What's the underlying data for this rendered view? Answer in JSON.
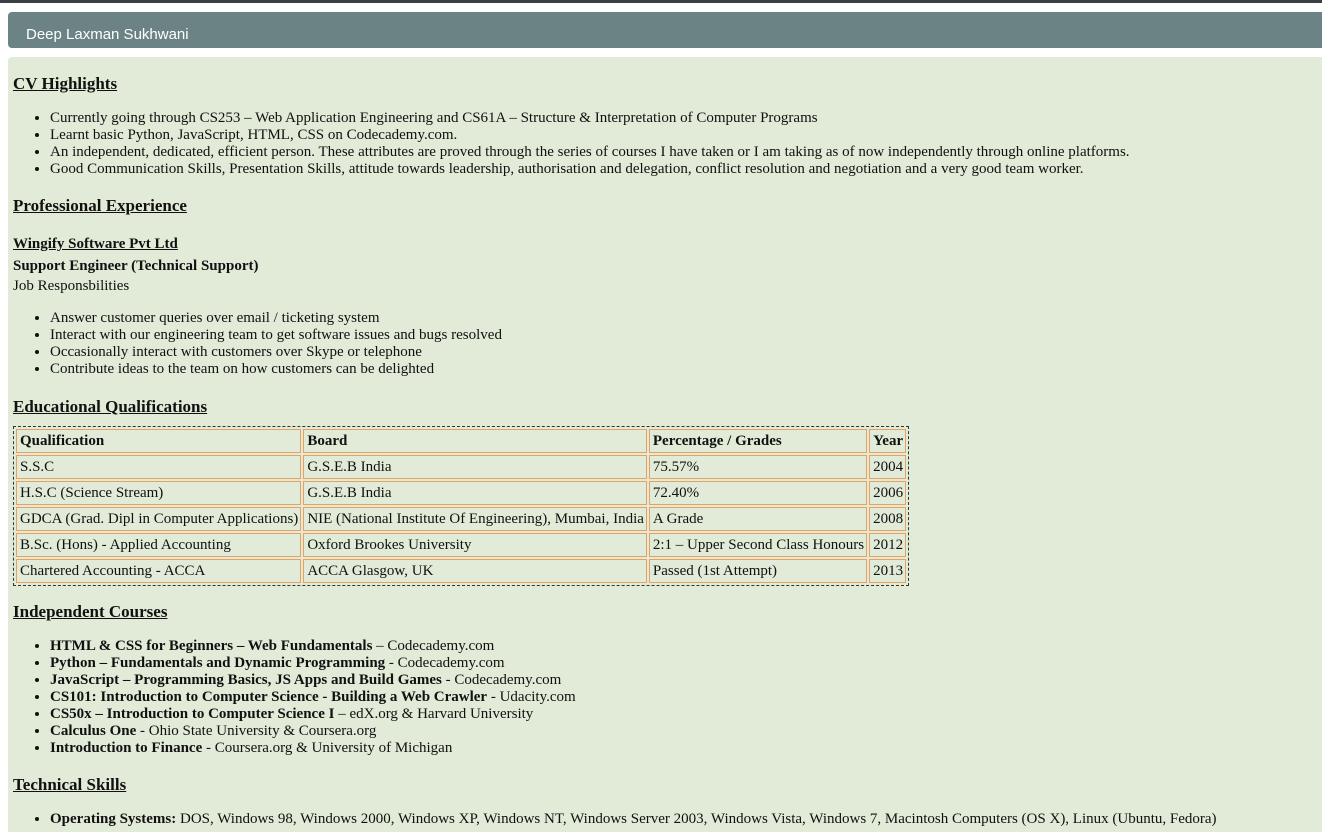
{
  "header": {
    "name": "Deep Laxman Sukhwani"
  },
  "cv_highlights": {
    "title": "CV Highlights",
    "items": [
      "Currently going through CS253 – Web Application Engineering and CS61A – Structure & Interpretation of Computer Programs",
      "Learnt basic Python, JavaScript, HTML, CSS on Codecademy.com.",
      "An independent, dedicated, efficient person. These attributes are proved through the series of courses I have taken or I am taking as of now independently through online platforms.",
      "Good Communication Skills, Presentation Skills, attitude towards leadership, authorisation and delegation, conflict resolution and negotiation and a very good team worker."
    ]
  },
  "experience": {
    "title": "Professional Experience",
    "company": "Wingify Software Pvt Ltd",
    "role": "Support Engineer (Technical Support)",
    "resp_label": "Job Responsbilities",
    "items": [
      "Answer customer queries over email / ticketing system",
      "Interact with our engineering team to get software issues and bugs resolved",
      "Occasionally interact with customers over Skype or telephone",
      "Contribute ideas to the team on how customers can be delighted"
    ]
  },
  "education": {
    "title": "Educational Qualifications",
    "columns": [
      "Qualification",
      "Board",
      "Percentage / Grades",
      "Year"
    ],
    "rows": [
      [
        "S.S.C",
        "G.S.E.B India",
        "75.57%",
        "2004"
      ],
      [
        "H.S.C (Science Stream)",
        "G.S.E.B India",
        "72.40%",
        "2006"
      ],
      [
        "GDCA (Grad. Dipl in Computer Applications)",
        "NIE (National Institute Of Engineering), Mumbai, India",
        "A Grade",
        "2008"
      ],
      [
        "B.Sc. (Hons) - Applied Accounting",
        "Oxford Brookes University",
        "2:1 – Upper Second Class Honours",
        "2012"
      ],
      [
        "Chartered Accounting - ACCA",
        "ACCA Glasgow, UK",
        "Passed (1st Attempt)",
        "2013"
      ]
    ]
  },
  "courses": {
    "title": "Independent Courses",
    "items": [
      {
        "name": "HTML & CSS for Beginners – Web Fundamentals",
        "provider": " – Codecademy.com"
      },
      {
        "name": "Python – Fundamentals and Dynamic Programming",
        "provider": " - Codecademy.com"
      },
      {
        "name": "JavaScript – Programming Basics, JS Apps and Build Games",
        "provider": " - Codecademy.com"
      },
      {
        "name": "CS101: Introduction to Computer Science - Building a Web Crawler",
        "provider": " - Udacity.com"
      },
      {
        "name": "CS50x – Introduction to Computer Science I",
        "provider": " – edX.org & Harvard University"
      },
      {
        "name": "Calculus One",
        "provider": " - Ohio State University & Coursera.org"
      },
      {
        "name": "Introduction to Finance",
        "provider": " - Coursera.org & University of Michigan"
      }
    ]
  },
  "skills": {
    "title": "Technical Skills",
    "items": [
      {
        "name": "Operating Systems:",
        "value": " DOS, Windows 98, Windows 2000, Windows XP, Windows NT, Windows Server 2003, Windows Vista, Windows 7, Macintosh Computers (OS X), Linux (Ubuntu, Fedora)"
      }
    ]
  }
}
